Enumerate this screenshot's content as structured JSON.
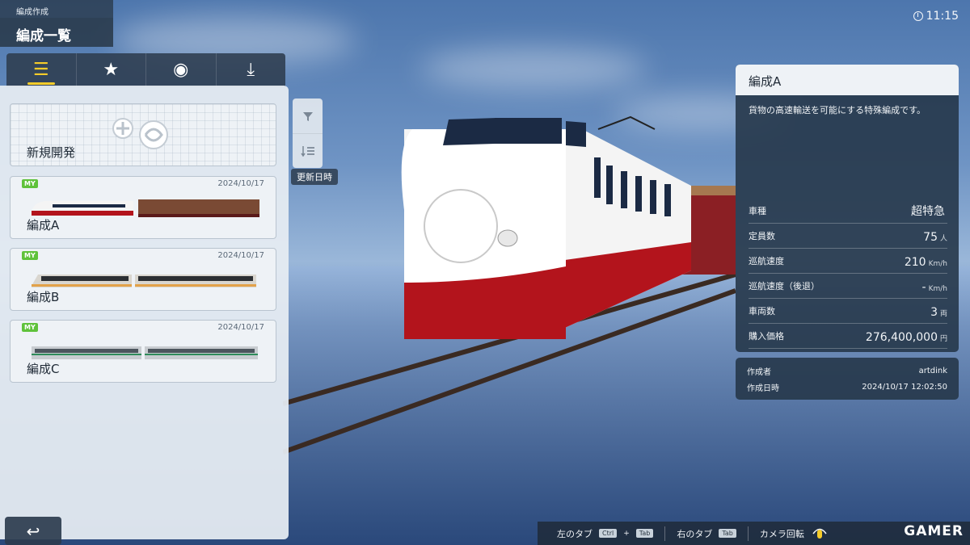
{
  "header": {
    "section": "編成作成",
    "title": "編成一覧"
  },
  "clock": "11:15",
  "tabs": [
    {
      "icon": "list-icon",
      "glyph": "☰"
    },
    {
      "icon": "star-icon",
      "glyph": "★"
    },
    {
      "icon": "user-icon",
      "glyph": "◉"
    },
    {
      "icon": "download-icon",
      "glyph": "⤓"
    }
  ],
  "new_card": {
    "label": "新規開発"
  },
  "formations": [
    {
      "name": "編成A",
      "date": "2024/10/17",
      "badge": "MY"
    },
    {
      "name": "編成B",
      "date": "2024/10/17",
      "badge": "MY"
    },
    {
      "name": "編成C",
      "date": "2024/10/17",
      "badge": "MY"
    }
  ],
  "sort": {
    "label": "更新日時"
  },
  "back_glyph": "↩",
  "info": {
    "title": "編成A",
    "description": "貨物の高速輸送を可能にする特殊編成です。",
    "specs": [
      {
        "key": "車種",
        "value": "超特急",
        "unit": ""
      },
      {
        "key": "定員数",
        "value": "75",
        "unit": "人"
      },
      {
        "key": "巡航速度",
        "value": "210",
        "unit": "Km/h"
      },
      {
        "key": "巡航速度（後退）",
        "value": "-",
        "unit": "Km/h"
      },
      {
        "key": "車両数",
        "value": "3",
        "unit": "両"
      },
      {
        "key": "購入価格",
        "value": "276,400,000",
        "unit": "円"
      }
    ],
    "author_label": "作成者",
    "author": "artdink",
    "created_label": "作成日時",
    "created": "2024/10/17 12:02:50"
  },
  "hints": {
    "left_tab": "左のタブ",
    "left_key1": "Ctrl",
    "left_key2": "Tab",
    "right_tab": "右のタブ",
    "right_key": "Tab",
    "camera": "カメラ回転"
  },
  "watermark": "GAMER",
  "colors": {
    "accent": "#f6cc2a",
    "badge": "#5fc23b",
    "panel_dark": "#26374a"
  }
}
